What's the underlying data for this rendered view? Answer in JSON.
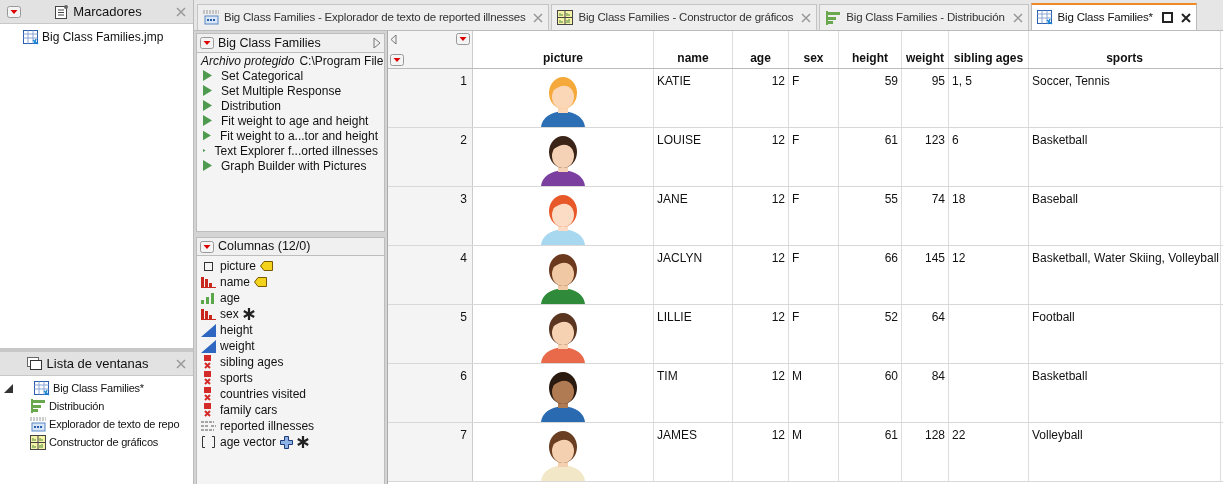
{
  "bookmarks": {
    "title": "Marcadores",
    "items": [
      {
        "label": "Big Class Families.jmp"
      }
    ]
  },
  "window_list": {
    "title": "Lista de ventanas",
    "tree": [
      {
        "label": "Big Class Families*",
        "kind": "table",
        "expanded": true,
        "children": [
          {
            "label": "Distribución",
            "kind": "distribution"
          },
          {
            "label": "Explorador de texto de repo",
            "kind": "text"
          },
          {
            "label": "Constructor de gráficos",
            "kind": "graph"
          }
        ]
      }
    ]
  },
  "tabs": [
    {
      "label": "Big Class Families - Explorador de texto de reported illnesses",
      "kind": "text",
      "selected": false
    },
    {
      "label": "Big Class Families - Constructor de gráficos",
      "kind": "graph",
      "selected": false
    },
    {
      "label": "Big Class Families - Distribución",
      "kind": "distribution",
      "selected": false
    },
    {
      "label": "Big Class Families*",
      "kind": "table",
      "selected": true
    }
  ],
  "table_panel": {
    "title": "Big Class Families",
    "note_label": "Archivo protegido",
    "note_value": "C:\\Program File",
    "scripts": [
      "Set Categorical",
      "Set Multiple Response",
      "Distribution",
      "Fit weight to age and height",
      "Fit weight to a...tor and height",
      "Text Explorer f...orted illnesses",
      "Graph Builder with Pictures"
    ]
  },
  "columns_panel": {
    "title": "Columnas (12/0)",
    "columns": [
      {
        "name": "picture",
        "kind": "none",
        "label_tag": true,
        "asterisk": false,
        "plus": false
      },
      {
        "name": "name",
        "kind": "nominal",
        "label_tag": true,
        "asterisk": false,
        "plus": false
      },
      {
        "name": "age",
        "kind": "ordinal",
        "label_tag": false,
        "asterisk": false,
        "plus": false
      },
      {
        "name": "sex",
        "kind": "nominal",
        "label_tag": false,
        "asterisk": true,
        "plus": false
      },
      {
        "name": "height",
        "kind": "continuous",
        "label_tag": false,
        "asterisk": false,
        "plus": false
      },
      {
        "name": "weight",
        "kind": "continuous",
        "label_tag": false,
        "asterisk": false,
        "plus": false
      },
      {
        "name": "sibling ages",
        "kind": "multiple",
        "label_tag": false,
        "asterisk": false,
        "plus": false
      },
      {
        "name": "sports",
        "kind": "multiple",
        "label_tag": false,
        "asterisk": false,
        "plus": false
      },
      {
        "name": "countries visited",
        "kind": "multiple",
        "label_tag": false,
        "asterisk": false,
        "plus": false
      },
      {
        "name": "family cars",
        "kind": "multiple",
        "label_tag": false,
        "asterisk": false,
        "plus": false
      },
      {
        "name": "reported illnesses",
        "kind": "unstructured",
        "label_tag": false,
        "asterisk": false,
        "plus": false
      },
      {
        "name": "age vector",
        "kind": "vector",
        "label_tag": false,
        "asterisk": true,
        "plus": true
      }
    ]
  },
  "table": {
    "columns": [
      "picture",
      "name",
      "age",
      "sex",
      "height",
      "weight",
      "sibling ages",
      "sports"
    ],
    "rows": [
      {
        "row": "1",
        "cells": [
          {
            "kind": "picture"
          },
          {
            "kind": "text",
            "text": "KATIE"
          },
          {
            "kind": "number",
            "text": "12"
          },
          {
            "kind": "text",
            "text": "F"
          },
          {
            "kind": "number",
            "text": "59"
          },
          {
            "kind": "number",
            "text": "95"
          },
          {
            "kind": "text",
            "text": "1, 5"
          },
          {
            "kind": "text",
            "text": "Soccer, Tennis"
          }
        ]
      },
      {
        "row": "2",
        "cells": [
          {
            "kind": "picture"
          },
          {
            "kind": "text",
            "text": "LOUISE"
          },
          {
            "kind": "number",
            "text": "12"
          },
          {
            "kind": "text",
            "text": "F"
          },
          {
            "kind": "number",
            "text": "61"
          },
          {
            "kind": "number",
            "text": "123"
          },
          {
            "kind": "text",
            "text": "6"
          },
          {
            "kind": "text",
            "text": "Basketball"
          }
        ]
      },
      {
        "row": "3",
        "cells": [
          {
            "kind": "picture"
          },
          {
            "kind": "text",
            "text": "JANE"
          },
          {
            "kind": "number",
            "text": "12"
          },
          {
            "kind": "text",
            "text": "F"
          },
          {
            "kind": "number",
            "text": "55"
          },
          {
            "kind": "number",
            "text": "74"
          },
          {
            "kind": "text",
            "text": "18"
          },
          {
            "kind": "text",
            "text": "Baseball"
          }
        ]
      },
      {
        "row": "4",
        "cells": [
          {
            "kind": "picture"
          },
          {
            "kind": "text",
            "text": "JACLYN"
          },
          {
            "kind": "number",
            "text": "12"
          },
          {
            "kind": "text",
            "text": "F"
          },
          {
            "kind": "number",
            "text": "66"
          },
          {
            "kind": "number",
            "text": "145"
          },
          {
            "kind": "text",
            "text": "12"
          },
          {
            "kind": "text",
            "text": "Basketball, Water Skiing, Volleyball"
          }
        ]
      },
      {
        "row": "5",
        "cells": [
          {
            "kind": "picture"
          },
          {
            "kind": "text",
            "text": "LILLIE"
          },
          {
            "kind": "number",
            "text": "12"
          },
          {
            "kind": "text",
            "text": "F"
          },
          {
            "kind": "number",
            "text": "52"
          },
          {
            "kind": "number",
            "text": "64"
          },
          {
            "kind": "empty"
          },
          {
            "kind": "text",
            "text": "Football"
          }
        ]
      },
      {
        "row": "6",
        "cells": [
          {
            "kind": "picture"
          },
          {
            "kind": "text",
            "text": "TIM"
          },
          {
            "kind": "number",
            "text": "12"
          },
          {
            "kind": "text",
            "text": "M"
          },
          {
            "kind": "number",
            "text": "60"
          },
          {
            "kind": "number",
            "text": "84"
          },
          {
            "kind": "empty"
          },
          {
            "kind": "text",
            "text": "Basketball"
          }
        ]
      },
      {
        "row": "7",
        "cells": [
          {
            "kind": "picture"
          },
          {
            "kind": "text",
            "text": "JAMES"
          },
          {
            "kind": "number",
            "text": "12"
          },
          {
            "kind": "text",
            "text": "M"
          },
          {
            "kind": "number",
            "text": "61"
          },
          {
            "kind": "number",
            "text": "128"
          },
          {
            "kind": "text",
            "text": "22"
          },
          {
            "kind": "text",
            "text": "Volleyball"
          }
        ]
      }
    ]
  }
}
